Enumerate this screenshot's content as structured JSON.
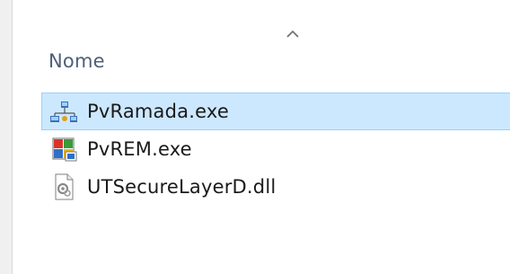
{
  "header": {
    "name_column_label": "Nome",
    "sort_icon": "chevron-up-icon"
  },
  "files": [
    {
      "name": "PvRamada.exe",
      "icon": "network-app-icon",
      "selected": true
    },
    {
      "name": "PvREM.exe",
      "icon": "colored-app-icon",
      "selected": false
    },
    {
      "name": "UTSecureLayerD.dll",
      "icon": "dll-file-icon",
      "selected": false
    }
  ],
  "colors": {
    "selection_fill": "#cce8ff",
    "selection_border": "#99d1ff",
    "header_text": "#4c607a"
  }
}
